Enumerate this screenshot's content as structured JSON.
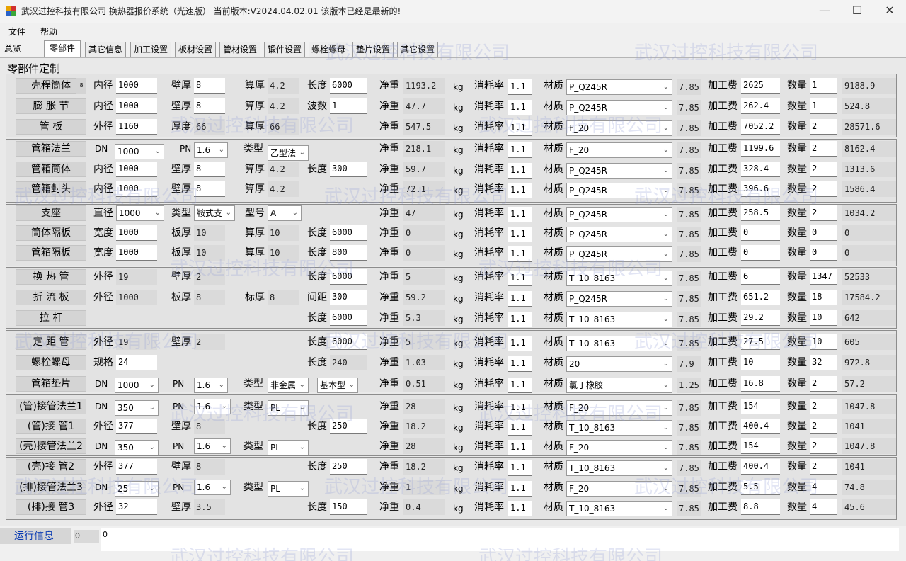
{
  "window": {
    "title": "武汉过控科技有限公司    换热器报价系统（光速版）  当前版本:V2024.04.02.01    该版本已经是最新的!",
    "minimize_glyph": "—",
    "maximize_glyph": "☐",
    "close_glyph": "✕"
  },
  "menu": {
    "file": "文件",
    "help": "帮助"
  },
  "tabs": [
    "总览",
    "零部件",
    "其它信息",
    "加工设置",
    "板材设置",
    "管材设置",
    "锻件设置",
    "螺栓螺母",
    "垫片设置",
    "其它设置"
  ],
  "group_title": "零部件定制",
  "watermark": "武汉过控科技有限公司",
  "labels": {
    "inner_dia": "内径",
    "outer_dia": "外径",
    "wall": "壁厚",
    "calc_thick": "算厚",
    "length": "长度",
    "net_weight": "净重",
    "kg": "kg",
    "loss_rate": "消耗率",
    "material": "材质",
    "process_fee": "加工费",
    "qty": "数量",
    "wave_count": "波数",
    "thickness": "厚度",
    "dn": "DN",
    "pn": "PN",
    "type": "类型",
    "diameter": "直径",
    "model": "型号",
    "width": "宽度",
    "plate_thick": "板厚",
    "mark_thick": "标厚",
    "spacing": "间距",
    "spec": "规格"
  },
  "rows": [
    {
      "name": "壳程筒体",
      "count": "8",
      "a": "1000",
      "b": "8",
      "c": "4.2",
      "d": "6000",
      "net": "1193.2",
      "loss": "1.1",
      "mat": "P_Q245R",
      "density": "7.85",
      "fee": "2625",
      "qty": "1",
      "total": "9188.9"
    },
    {
      "name": "膨 胀 节",
      "a": "1000",
      "b": "8",
      "c": "4.2",
      "d": "1",
      "net": "47.7",
      "loss": "1.1",
      "mat": "P_Q245R",
      "density": "7.85",
      "fee": "262.4",
      "qty": "1",
      "total": "524.8"
    },
    {
      "name": "管    板",
      "a": "1160",
      "b": "66",
      "c": "66",
      "net": "547.5",
      "loss": "1.1",
      "mat": "F_20",
      "density": "7.85",
      "fee": "7052.2",
      "qty": "2",
      "total": "28571.6"
    },
    {
      "name": "管箱法兰",
      "dn": "1000",
      "pn": "1.6",
      "t1": "乙型法",
      "net": "218.1",
      "loss": "1.1",
      "mat": "F_20",
      "density": "7.85",
      "fee": "1199.6",
      "qty": "2",
      "total": "8162.4"
    },
    {
      "name": "管箱筒体",
      "a": "1000",
      "b": "8",
      "c": "4.2",
      "d": "300",
      "net": "59.7",
      "loss": "1.1",
      "mat": "P_Q245R",
      "density": "7.85",
      "fee": "328.4",
      "qty": "2",
      "total": "1313.6"
    },
    {
      "name": "管箱封头",
      "a": "1000",
      "b": "8",
      "c": "4.2",
      "net": "72.1",
      "loss": "1.1",
      "mat": "P_Q245R",
      "density": "7.85",
      "fee": "396.6",
      "qty": "2",
      "total": "1586.4"
    },
    {
      "name": "支座",
      "dia": "1000",
      "t1": "鞍式支",
      "model": "A",
      "net": "47",
      "loss": "1.1",
      "mat": "P_Q245R",
      "density": "7.85",
      "fee": "258.5",
      "qty": "2",
      "total": "1034.2"
    },
    {
      "name": "筒体隔板",
      "a": "1000",
      "b": "10",
      "c": "10",
      "d": "6000",
      "net": "0",
      "loss": "1.1",
      "mat": "P_Q245R",
      "density": "7.85",
      "fee": "0",
      "qty": "0",
      "total": "0"
    },
    {
      "name": "管箱隔板",
      "a": "1000",
      "b": "10",
      "c": "10",
      "d": "800",
      "net": "0",
      "loss": "1.1",
      "mat": "P_Q245R",
      "density": "7.85",
      "fee": "0",
      "qty": "0",
      "total": "0"
    },
    {
      "name": "换 热 管",
      "a": "19",
      "b": "2",
      "d": "6000",
      "net": "5",
      "loss": "1.1",
      "mat": "T_10_8163",
      "density": "7.85",
      "fee": "6",
      "qty": "1347",
      "total": "52533"
    },
    {
      "name": "折 流 板",
      "a": "1000",
      "b": "8",
      "c": "8",
      "d": "300",
      "net": "59.2",
      "loss": "1.1",
      "mat": "P_Q245R",
      "density": "7.85",
      "fee": "651.2",
      "qty": "18",
      "total": "17584.2"
    },
    {
      "name": "拉    杆",
      "d": "6000",
      "net": "5.3",
      "loss": "1.1",
      "mat": "T_10_8163",
      "density": "7.85",
      "fee": "29.2",
      "qty": "10",
      "total": "642"
    },
    {
      "name": "定 距 管",
      "a": "19",
      "b": "2",
      "d": "6000",
      "net": "5",
      "loss": "1.1",
      "mat": "T_10_8163",
      "density": "7.85",
      "fee": "27.5",
      "qty": "10",
      "total": "605"
    },
    {
      "name": "螺栓螺母",
      "a": "24",
      "d": "240",
      "net": "1.03",
      "loss": "1.1",
      "mat": "20",
      "density": "7.9",
      "fee": "10",
      "qty": "32",
      "total": "972.8"
    },
    {
      "name": "管箱垫片",
      "dn": "1000",
      "pn": "1.6",
      "t1": "非金属",
      "t2": "基本型",
      "net": "0.51",
      "loss": "1.1",
      "mat": "氯丁橡胶",
      "density": "1.25",
      "fee": "16.8",
      "qty": "2",
      "total": "57.2"
    },
    {
      "name": "(管)接管法兰1",
      "dn": "350",
      "pn": "1.6",
      "t1": "PL",
      "net": "28",
      "loss": "1.1",
      "mat": "F_20",
      "density": "7.85",
      "fee": "154",
      "qty": "2",
      "total": "1047.8"
    },
    {
      "name": "(管)接    管1",
      "a": "377",
      "b": "8",
      "d": "250",
      "net": "18.2",
      "loss": "1.1",
      "mat": "T_10_8163",
      "density": "7.85",
      "fee": "400.4",
      "qty": "2",
      "total": "1041"
    },
    {
      "name": "(壳)接管法兰2",
      "dn": "350",
      "pn": "1.6",
      "t1": "PL",
      "net": "28",
      "loss": "1.1",
      "mat": "F_20",
      "density": "7.85",
      "fee": "154",
      "qty": "2",
      "total": "1047.8"
    },
    {
      "name": "(壳)接    管2",
      "a": "377",
      "b": "8",
      "d": "250",
      "net": "18.2",
      "loss": "1.1",
      "mat": "T_10_8163",
      "density": "7.85",
      "fee": "400.4",
      "qty": "2",
      "total": "1041"
    },
    {
      "name": "(排)接管法兰3",
      "dn": "25",
      "pn": "1.6",
      "t1": "PL",
      "net": "1",
      "loss": "1.1",
      "mat": "F_20",
      "density": "7.85",
      "fee": "5.5",
      "qty": "4",
      "total": "74.8"
    },
    {
      "name": "(排)接    管3",
      "a": "32",
      "b": "3.5",
      "d": "150",
      "net": "0.4",
      "loss": "1.1",
      "mat": "T_10_8163",
      "density": "7.85",
      "fee": "8.8",
      "qty": "4",
      "total": "45.6"
    }
  ],
  "status": {
    "label": "运行信息",
    "num": "0",
    "text": "0"
  },
  "colors": {
    "status_label": "#0a3bb3",
    "watermark": "#9aa3d8"
  }
}
